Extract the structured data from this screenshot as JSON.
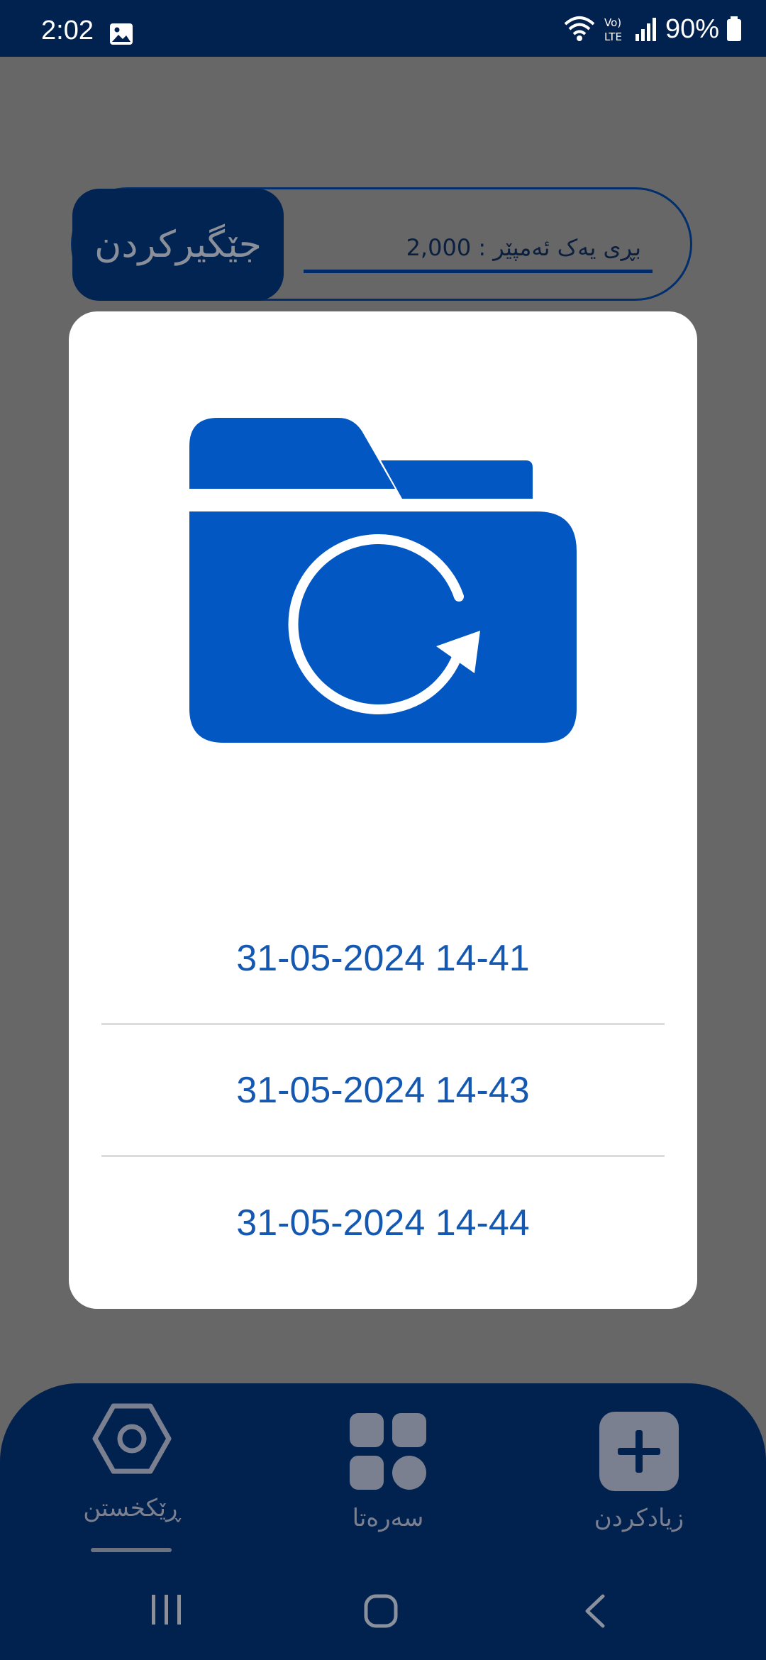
{
  "status_bar": {
    "time": "2:02",
    "battery": "90%",
    "icons": [
      "image-icon",
      "wifi-icon",
      "volte-icon",
      "signal-icon",
      "battery-icon"
    ]
  },
  "main": {
    "confirm_button_label": "جێگیرکردن",
    "amount_text": "بڕی یەک ئەمپێر : 2,000"
  },
  "dialog": {
    "icon": "folder-restore-icon",
    "backups": [
      "31-05-2024 14-41",
      "31-05-2024 14-43",
      "31-05-2024 14-44"
    ]
  },
  "bottom_nav": {
    "items": [
      {
        "label": "ڕێکخستن",
        "icon": "settings-hexagon-icon"
      },
      {
        "label": "سەرەتا",
        "icon": "grid-icon"
      },
      {
        "label": "زیادکردن",
        "icon": "add-icon"
      }
    ]
  },
  "colors": {
    "navy": "#01214f",
    "dialog_text": "#1558b2",
    "folder": "#0257c2",
    "scrim": "#676767"
  }
}
